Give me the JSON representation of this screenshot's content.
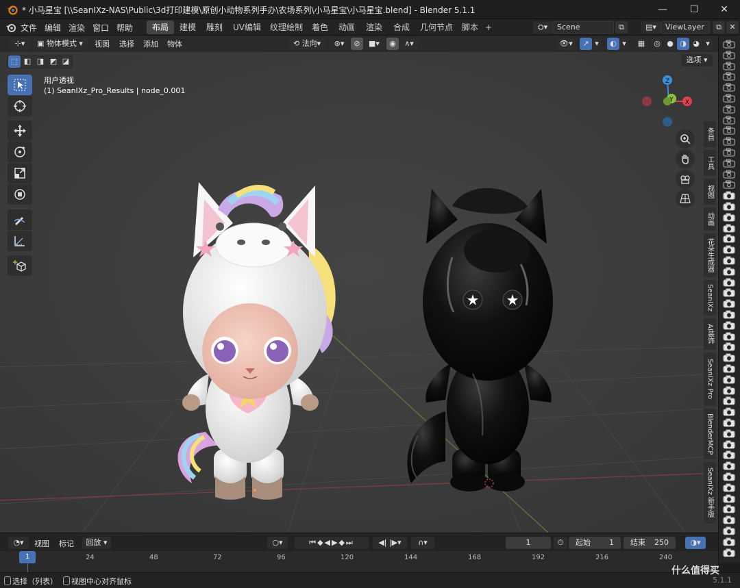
{
  "window": {
    "title": "* 小马星宝 [\\\\SeanIXz-NAS\\Public\\3d打印建模\\原创小动物系列手办\\农场系列\\小马星宝\\小马星宝.blend] - Blender 5.1.1",
    "minimize": "—",
    "maximize": "☐",
    "close": "✕"
  },
  "menu": {
    "items": [
      "文件",
      "编辑",
      "渲染",
      "窗口",
      "帮助"
    ]
  },
  "workspace_tabs": [
    "布局",
    "建模",
    "雕刻",
    "UV编辑",
    "纹理绘制",
    "着色",
    "动画",
    "渲染",
    "合成",
    "几何节点",
    "脚本"
  ],
  "workspace_add": "+",
  "scene": {
    "name": "Scene"
  },
  "viewlayer": {
    "name": "ViewLayer"
  },
  "viewport_header": {
    "mode": "物体模式",
    "menus": [
      "视图",
      "选择",
      "添加",
      "物体"
    ],
    "orientation": "法向",
    "options": "选项"
  },
  "overlay_text": {
    "view_name": "用户透视",
    "object_info": "(1) SeanIXz_Pro_Results | node_0.001"
  },
  "gizmo": {
    "x": "X",
    "y": "Y",
    "z": "Z"
  },
  "sidebar_tabs": [
    "条目",
    "工具",
    "视图",
    "动画",
    "花朵生成器",
    "SeanIXz",
    "AI装饰",
    "SeanIXz Pro",
    "BlenderMCP",
    "SeanIXz 新手版"
  ],
  "timeline": {
    "menus": [
      "视图",
      "标记",
      "回放"
    ],
    "current_frame": "1",
    "start_label": "起始",
    "start": "1",
    "end_label": "结束",
    "end": "250",
    "ticks": [
      "1",
      "24",
      "48",
      "72",
      "96",
      "120",
      "144",
      "168",
      "192",
      "216",
      "240"
    ]
  },
  "statusbar": {
    "select": "选择（列表）",
    "center": "视图中心对齐鼠标",
    "version": "5.1.1"
  },
  "watermark": "什么值得买",
  "colors": {
    "accent": "#4772b3",
    "axis_x": "#e2404f",
    "axis_y": "#8bc23c",
    "axis_z": "#3a8fd9"
  }
}
